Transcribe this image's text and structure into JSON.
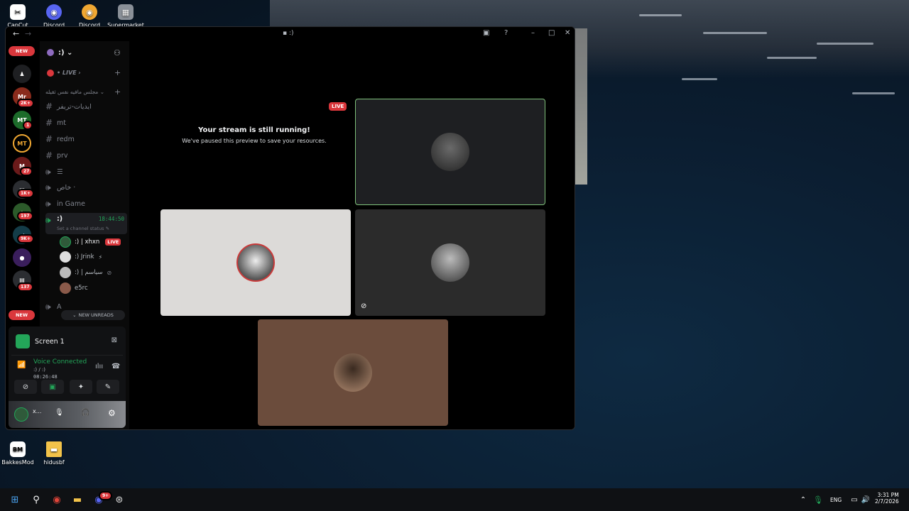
{
  "desktop": {
    "top_icons": [
      {
        "label": "CapCut",
        "icon": "capcut-icon",
        "color": "#ffffff"
      },
      {
        "label": "Discord",
        "icon": "discord-icon",
        "color": "#5865f2"
      },
      {
        "label": "Discord",
        "icon": "discord-canary-icon",
        "color": "#f0a732"
      },
      {
        "label": "Supermarket",
        "icon": "supermarket-icon",
        "color": "#a0a8b0"
      }
    ],
    "bottom_icons": [
      {
        "label": "BakkesMod",
        "icon": "bakkesmod-icon",
        "glyph": "BM"
      },
      {
        "label": "hidusbf",
        "icon": "folder-icon"
      }
    ]
  },
  "window": {
    "title": ":)",
    "back_glyph": "←",
    "forward_glyph": "→"
  },
  "rail": {
    "new_top": "NEW",
    "new_bottom": "NEW",
    "servers": [
      {
        "name": "home",
        "glyph": "",
        "badge": "",
        "color": "#1e1f22"
      },
      {
        "name": "server-mr",
        "glyph": "Mr",
        "badge": "2K+",
        "color": "#8a2b1c"
      },
      {
        "name": "server-mt",
        "glyph": "MT",
        "badge": "1",
        "color": "#1c6b2a"
      },
      {
        "name": "server-mt2",
        "glyph": "MT",
        "badge": "",
        "color": "#000000"
      },
      {
        "name": "server-m",
        "glyph": "M",
        "badge": "27",
        "color": "#6b1a1a"
      },
      {
        "name": "server-folder",
        "glyph": "",
        "badge": "1K+",
        "color": "#2b2d31"
      },
      {
        "name": "server-green",
        "glyph": "",
        "badge": "197",
        "color": "#2c5a2a"
      },
      {
        "name": "server-teal",
        "glyph": "",
        "badge": "9K+",
        "color": "#143c48"
      },
      {
        "name": "server-purple",
        "glyph": "",
        "badge": "",
        "color": "#3a1e5c"
      },
      {
        "name": "server-folder2",
        "glyph": "",
        "badge": "137",
        "color": "#2b2d31"
      }
    ]
  },
  "sidebar": {
    "server_name": ":)",
    "live_category": "• LIVE",
    "category": "مجلس مافیه نفس ثقیله",
    "channels": [
      {
        "type": "text",
        "name": "ایدیات-تریفر"
      },
      {
        "type": "text",
        "name": "mt"
      },
      {
        "type": "text",
        "name": "redm"
      },
      {
        "type": "text",
        "name": "prv"
      },
      {
        "type": "voice",
        "name": "☰"
      },
      {
        "type": "voice",
        "name": "خاص ·"
      },
      {
        "type": "voice",
        "name": "in Game"
      }
    ],
    "active_channel": {
      "name": ":)",
      "time": "18:44:50",
      "status": "Set a channel status"
    },
    "members": [
      {
        "name": ":) | xhxn",
        "live": "LIVE"
      },
      {
        "name": ":) Jrink",
        "live": ""
      },
      {
        "name": ":) | سیاسم",
        "live": ""
      },
      {
        "name": "e5rc",
        "live": ""
      }
    ],
    "after_channel": "A",
    "new_unreads": "NEW UNREADS"
  },
  "panel": {
    "screen_label": "Screen 1",
    "voice_status": "Voice Connected",
    "voice_channel": ":) / :)",
    "voice_time": "08:26:48",
    "user_name": "x..."
  },
  "stage": {
    "live_tag": "LIVE",
    "stream_title": "Your stream is still running!",
    "stream_sub": "We've paused this preview to save your resources."
  },
  "taskbar": {
    "lang": "ENG",
    "time": "3:31 PM",
    "date": "2/7/2026",
    "discord_badge": "9+"
  }
}
